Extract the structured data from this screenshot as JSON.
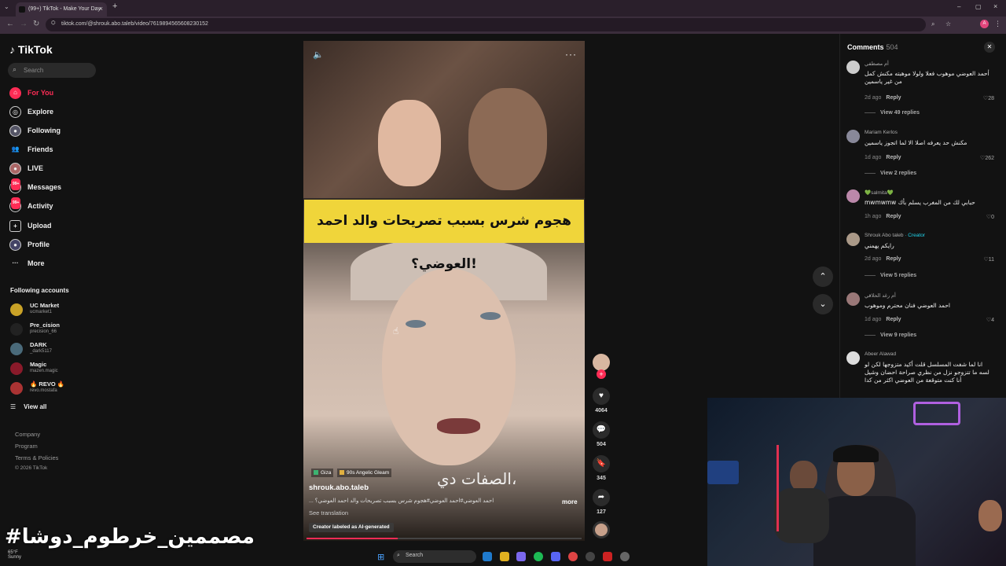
{
  "browser": {
    "tab_title": "(99+) TikTok - Make Your Day",
    "url": "tiktok.com/@shrouk.abo.taleb/video/7619894565608230152"
  },
  "sidebar": {
    "logo": "TikTok",
    "search_placeholder": "Search",
    "nav": [
      {
        "label": "For You",
        "icon": "home-icon",
        "active": true
      },
      {
        "label": "Explore",
        "icon": "compass-icon"
      },
      {
        "label": "Following",
        "icon": "following-icon"
      },
      {
        "label": "Friends",
        "icon": "friends-icon"
      },
      {
        "label": "LIVE",
        "icon": "live-icon"
      },
      {
        "label": "Messages",
        "icon": "messages-icon",
        "badge": "99+"
      },
      {
        "label": "Activity",
        "icon": "activity-icon",
        "badge": "99+"
      },
      {
        "label": "Upload",
        "icon": "upload-icon"
      },
      {
        "label": "Profile",
        "icon": "profile-icon"
      },
      {
        "label": "More",
        "icon": "more-icon"
      }
    ],
    "following_title": "Following accounts",
    "accounts": [
      {
        "name": "UC Market",
        "handle": "ucmarket1"
      },
      {
        "name": "Pre_cision",
        "handle": "precision_66"
      },
      {
        "name": "DARK",
        "handle": "_dark5117"
      },
      {
        "name": "Magic",
        "handle": "mazen.magic"
      },
      {
        "name": "🔥 REVO 🔥",
        "handle": "revo.mostafa"
      }
    ],
    "view_all": "View all",
    "footer": [
      "Company",
      "Program",
      "Terms & Policies",
      "© 2026 TikTok"
    ]
  },
  "video": {
    "banner": "هجوم شرس بسبب تصريحات والد احمد العوضي؟!",
    "caption_overlay": "الصفات دي،",
    "tags": [
      "Giza",
      "90s Angelic Gleam"
    ],
    "author": "shrouk.abo.taleb",
    "description": "... احمد العوضي#احمد العوضي#هجوم شرس بسبب تصريحات والد احمد العوضي؟",
    "more": "more",
    "see_translation": "See translation",
    "ai_label": "Creator labeled as AI-generated",
    "progress": 0.33,
    "likes": "4064",
    "comments": "504",
    "saves": "345",
    "shares": "127"
  },
  "comments": {
    "title": "Comments",
    "count": "504",
    "items": [
      {
        "user": "أم مصطفي",
        "text": "أحمد العوضي موهوب فعلا ولولا موهبته مكنش كمل من غير ياسمين",
        "time": "2d ago",
        "likes": "28",
        "replies": "View 49 replies"
      },
      {
        "user": "Mariam Kerlos",
        "text": "مكنش حد يعرفه اصلا الا لما اتجوز ياسمين",
        "time": "1d ago",
        "likes": "262",
        "replies": "View 2 replies"
      },
      {
        "user": "💚salmita💚",
        "text": "حبابي لك من المغرب يسلم بأك mwmwmw",
        "time": "1h ago",
        "likes": "0",
        "replies": ""
      },
      {
        "user": "Shrouk Abo taleb",
        "creator": "· Creator",
        "text": "رايكم يهمني",
        "time": "2d ago",
        "likes": "11",
        "replies": "View 5 replies"
      },
      {
        "user": "أم رغد الحلاقي",
        "text": "احمد العوضي فنان محترم وموهوب",
        "time": "1d ago",
        "likes": "4",
        "replies": "View 9 replies"
      },
      {
        "user": "Abeer Alawad",
        "text": "انا لما شفت المسلسل قلت أكيد متزوجها لكن لو لسه ما تتزوجو نزل من نظري صراحة احضان وشيل أنا كنت متوقعة من العوضي اكثر من كدا",
        "time": "",
        "likes": "",
        "replies": ""
      }
    ],
    "reply_label": "Reply"
  },
  "taskbar": {
    "search": "Search",
    "weather_temp": "65°F",
    "weather_desc": "Sunny"
  },
  "overlay_watermark": "#مصممين_خرطوم_دوشا"
}
